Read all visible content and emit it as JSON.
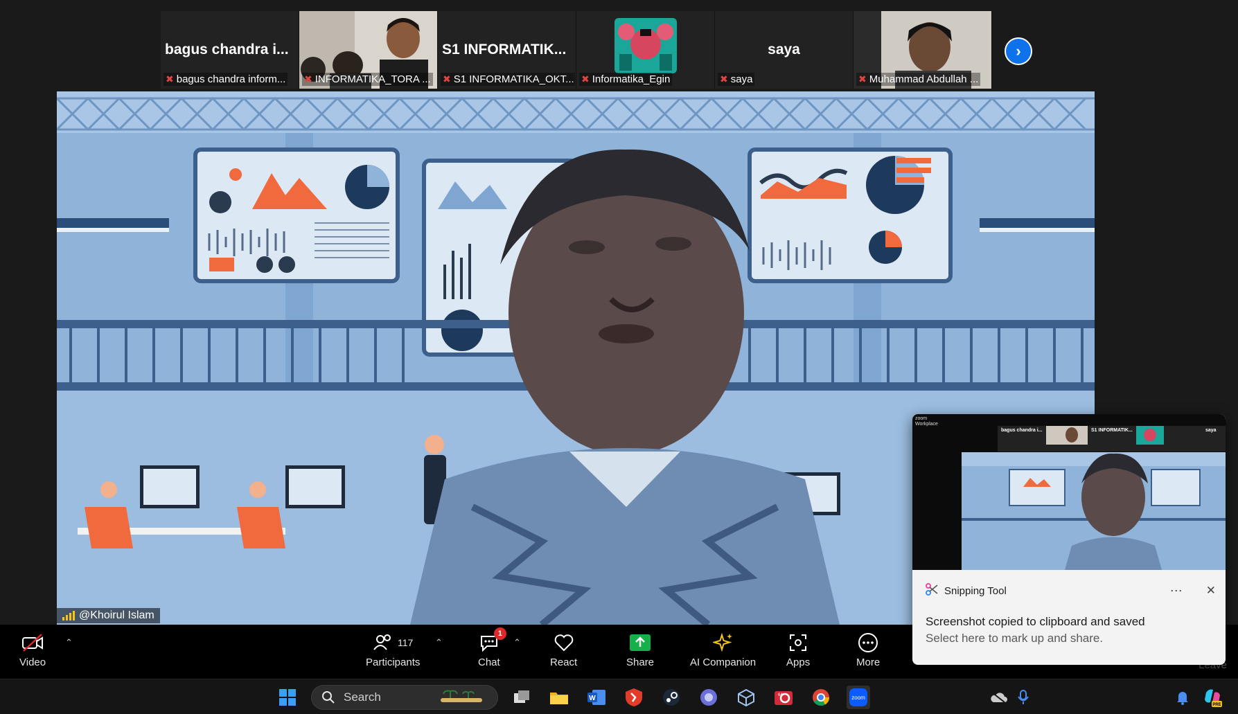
{
  "gallery": {
    "tiles": [
      {
        "big_name": "bagus chandra i...",
        "caption": "bagus chandra inform..."
      },
      {
        "big_name": "",
        "caption": "INFORMATIKA_TORA ..."
      },
      {
        "big_name": "S1  INFORMATIK...",
        "caption": "S1 INFORMATIKA_OKT..."
      },
      {
        "big_name": "",
        "caption": "Informatika_Egin"
      },
      {
        "big_name": "saya",
        "caption": "saya"
      },
      {
        "big_name": "",
        "caption": "Muhammad Abdullah ..."
      }
    ],
    "next_icon": "chevron-right-icon"
  },
  "main": {
    "speaker_name": "@Khoirul Islam"
  },
  "toolbar": {
    "video_label": "Video",
    "participants_label": "Participants",
    "participants_count": "117",
    "chat_label": "Chat",
    "chat_badge": "1",
    "react_label": "React",
    "share_label": "Share",
    "ai_label": "AI Companion",
    "apps_label": "Apps",
    "more_label": "More",
    "leave_label": "Leave"
  },
  "toast": {
    "app_name": "Snipping Tool",
    "title": "Screenshot copied to clipboard and saved",
    "subtitle": "Select here to mark up and share.",
    "thumb_logo_line1": "zoom",
    "thumb_logo_line2": "Workplace",
    "thumb_names": [
      "bagus chandra i...",
      "S1  INFORMATIK...",
      "saya"
    ]
  },
  "taskbar": {
    "search_placeholder": "Search"
  },
  "colors": {
    "zoom_blue": "#0e72ed",
    "mic_off_red": "#e0443e",
    "share_green": "#16b04a",
    "badge_red": "#e02828"
  }
}
